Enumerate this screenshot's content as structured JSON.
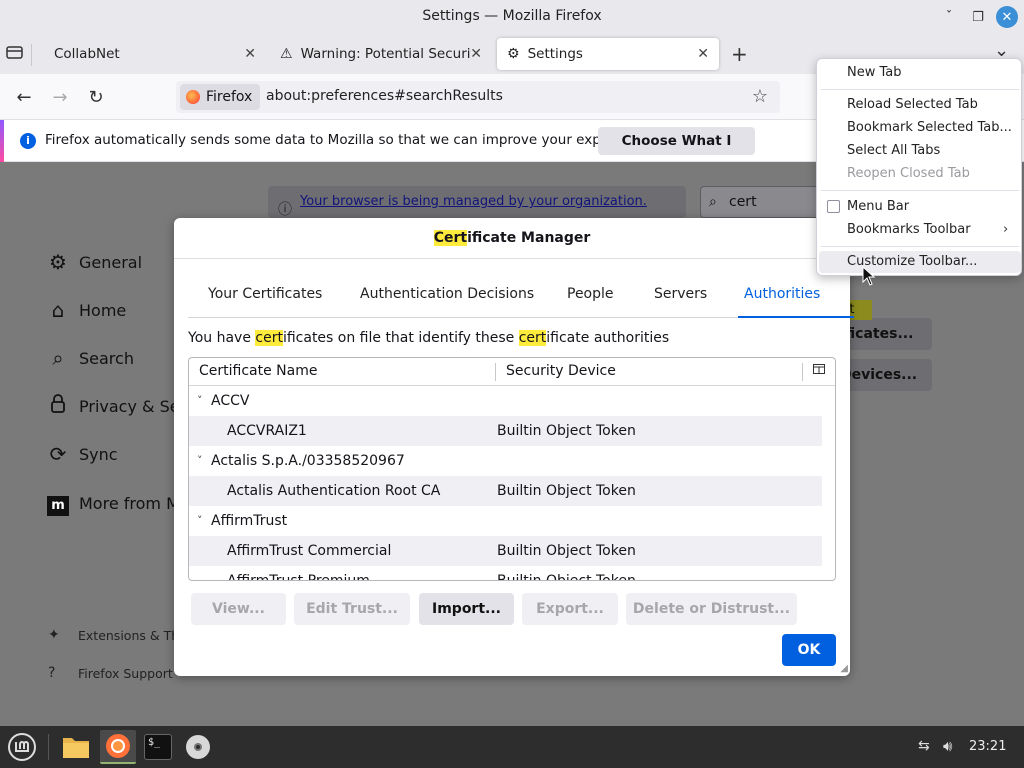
{
  "window": {
    "title": "Settings — Mozilla Firefox",
    "controls": {
      "minimize": "ˇ",
      "maximize": "❐",
      "close": "✕"
    }
  },
  "tabs": [
    {
      "label": "CollabNet",
      "icon": "none",
      "active": false
    },
    {
      "label": "Warning: Potential Security",
      "icon": "warning-icon",
      "active": false
    },
    {
      "label": "Settings",
      "icon": "gear-icon",
      "active": true
    }
  ],
  "tab_strip": {
    "new_tab": "+",
    "list_all": "⌄"
  },
  "navbar": {
    "back": "←",
    "forward": "→",
    "reload": "↻",
    "identity_label": "Firefox",
    "url": "about:preferences#searchResults",
    "bookmark_star": "☆"
  },
  "notification": {
    "message": "Firefox automatically sends some data to Mozilla so that we can improve your experience.",
    "button": "Choose What I Share"
  },
  "settings_page": {
    "managed_notice": "Your browser is being managed by your organization.",
    "search_value": "cert",
    "sidebar": [
      {
        "label": "General",
        "icon": "gear-icon"
      },
      {
        "label": "Home",
        "icon": "home-icon"
      },
      {
        "label": "Search",
        "icon": "search-icon"
      },
      {
        "label": "Privacy & Secu",
        "icon": "lock-icon"
      },
      {
        "label": "Sync",
        "icon": "sync-icon"
      },
      {
        "label": "More from M",
        "icon": "mozilla-icon"
      }
    ],
    "sidebar_footer": [
      {
        "label": "Extensions & Th",
        "icon": "puzzle-icon"
      },
      {
        "label": "Firefox Support",
        "icon": "help-icon"
      }
    ],
    "bg_buttons": [
      "ificates...",
      "Devices..."
    ],
    "bg_highlight": "rt"
  },
  "dialog": {
    "title_highlight": "Cert",
    "title_rest": "ificate Manager",
    "tabs": [
      "Your Certificates",
      "Authentication Decisions",
      "People",
      "Servers",
      "Authorities"
    ],
    "active_tab": "Authorities",
    "desc_parts": [
      "You have ",
      "cert",
      "ificates on file that identify these ",
      "cert",
      "ificate authorities"
    ],
    "columns": [
      "Certificate Name",
      "Security Device"
    ],
    "rows": [
      {
        "type": "group",
        "name": "ACCV"
      },
      {
        "type": "cert",
        "name": "ACCVRAIZ1",
        "device": "Builtin Object Token"
      },
      {
        "type": "group",
        "name": "Actalis S.p.A./03358520967"
      },
      {
        "type": "cert",
        "name": "Actalis Authentication Root CA",
        "device": "Builtin Object Token"
      },
      {
        "type": "group",
        "name": "AffirmTrust"
      },
      {
        "type": "cert",
        "name": "AffirmTrust Commercial",
        "device": "Builtin Object Token"
      },
      {
        "type": "cert",
        "name": "AffirmTrust Premium",
        "device": "Builtin Object Token"
      }
    ],
    "buttons": [
      {
        "label": "View...",
        "enabled": false
      },
      {
        "label": "Edit Trust...",
        "enabled": false
      },
      {
        "label": "Import...",
        "enabled": true
      },
      {
        "label": "Export...",
        "enabled": false
      },
      {
        "label": "Delete or Distrust...",
        "enabled": false
      }
    ],
    "ok": "OK"
  },
  "context_menu": {
    "items": [
      {
        "label": "New Tab",
        "disabled": false
      },
      {
        "label": "Reload Selected Tab",
        "disabled": false
      },
      {
        "label": "Bookmark Selected Tab...",
        "disabled": false
      },
      {
        "label": "Select All Tabs",
        "disabled": false
      },
      {
        "label": "Reopen Closed Tab",
        "disabled": true
      },
      {
        "label": "Menu Bar",
        "disabled": false,
        "checkbox": true,
        "checked": false
      },
      {
        "label": "Bookmarks Toolbar",
        "disabled": false,
        "submenu": true
      },
      {
        "label": "Customize Toolbar...",
        "disabled": false,
        "hovered": true
      }
    ]
  },
  "taskbar": {
    "apps": [
      "menu-icon",
      "files-icon",
      "firefox-icon",
      "terminal-icon",
      "disc-icon"
    ],
    "terminal_glyph": "$_",
    "clock": "23:21"
  },
  "colors": {
    "accent": "#0060df",
    "highlight": "#ffeb3b",
    "taskbar": "#2d2d2d"
  }
}
